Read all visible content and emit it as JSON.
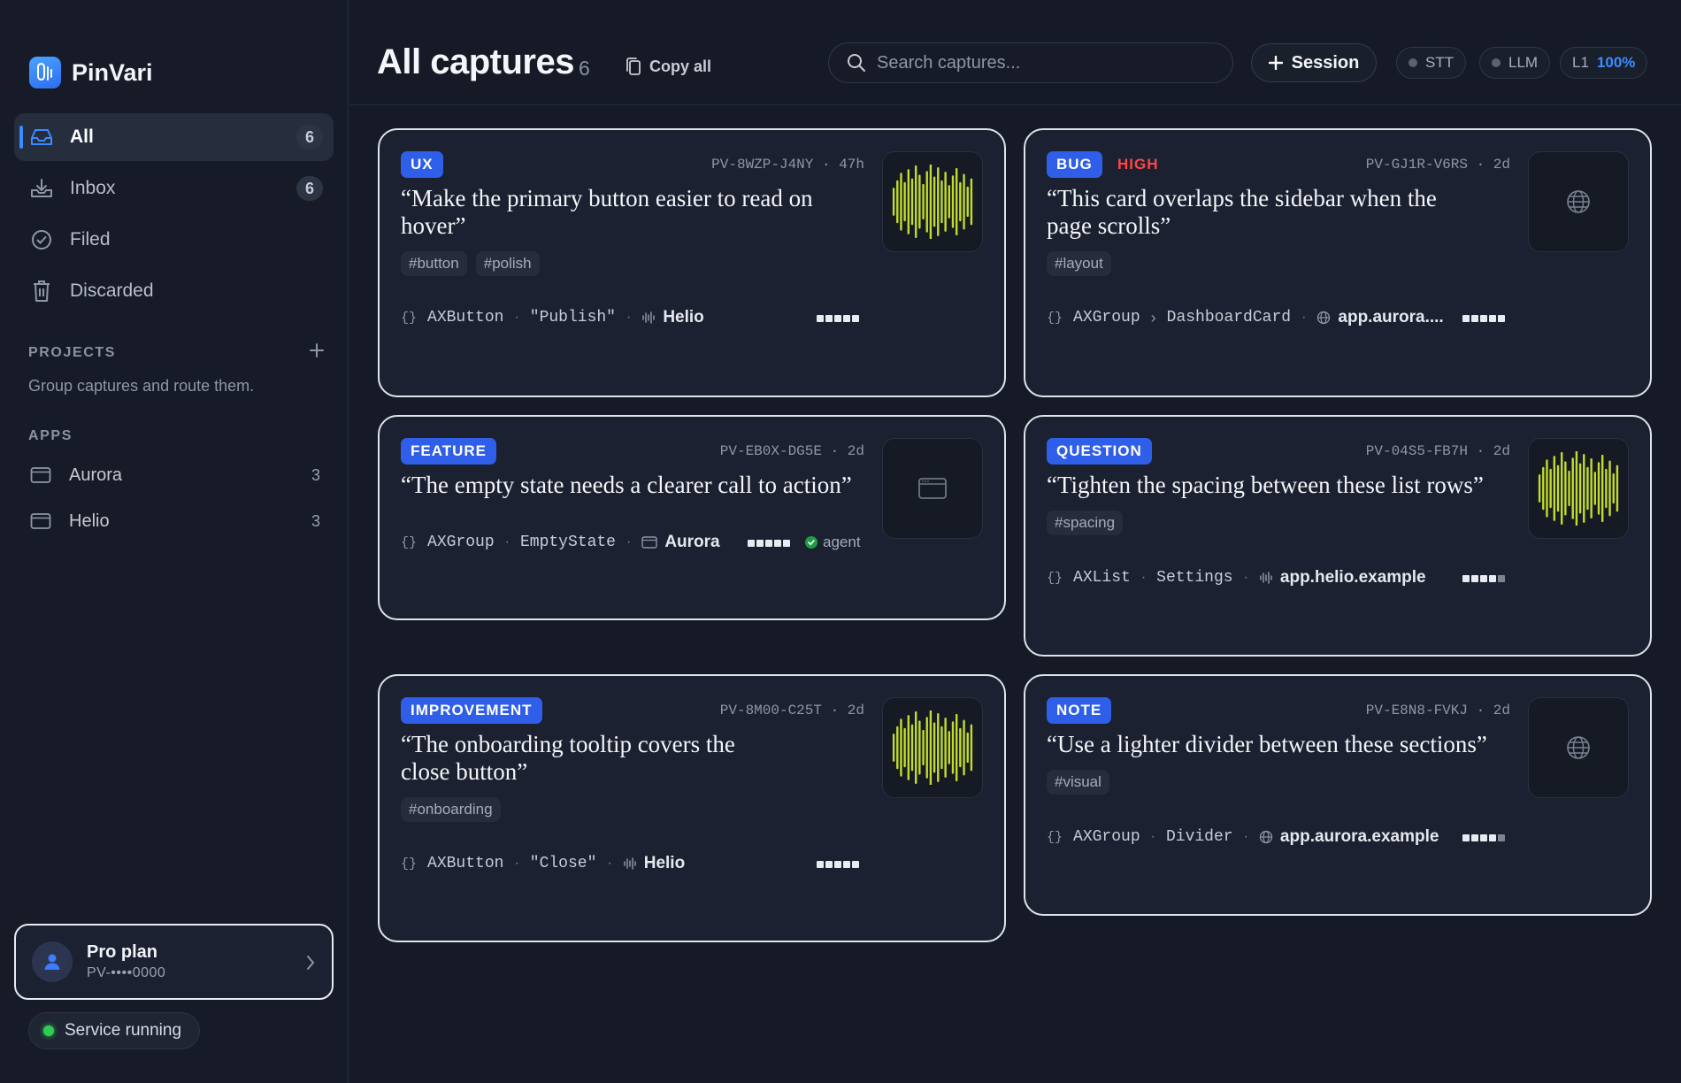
{
  "app": {
    "name": "PinVari"
  },
  "sidebar": {
    "nav": [
      {
        "label": "All",
        "count": "6",
        "icon": "inbox-tray-icon"
      },
      {
        "label": "Inbox",
        "count": "6",
        "icon": "download-tray-icon"
      },
      {
        "label": "Filed",
        "icon": "check-circle-icon"
      },
      {
        "label": "Discarded",
        "icon": "trash-icon"
      }
    ],
    "projects": {
      "title": "PROJECTS",
      "description": "Group captures and route them."
    },
    "apps": {
      "title": "APPS",
      "items": [
        {
          "label": "Aurora",
          "count": "3"
        },
        {
          "label": "Helio",
          "count": "3"
        }
      ]
    },
    "plan": {
      "name": "Pro plan",
      "id": "PV-••••0000"
    },
    "service": {
      "label": "Service running",
      "color": "#2ecc52"
    }
  },
  "header": {
    "title": "All captures",
    "count": "6",
    "copy_all": "Copy all",
    "search_placeholder": "Search captures...",
    "session_label": "Session",
    "status": {
      "stt": "STT",
      "llm": "LLM",
      "level": "L1",
      "percent": "100%"
    }
  },
  "colors": {
    "accent": "#2f5fe8",
    "priority_high": "#ff4545",
    "waveform": "#c3dc2b",
    "background": "#151a26"
  },
  "cards": [
    {
      "tag": "UX",
      "id": "PV-8WZP-J4NY",
      "age": "47h",
      "quote": "“Make the primary button easier to read on hover”",
      "hashtags": [
        "#button",
        "#polish"
      ],
      "role": "AXButton",
      "element": "\"Publish\"",
      "app": "Helio",
      "app_icon": "waveform-icon",
      "rating": 5,
      "thumbnail": "waveform"
    },
    {
      "tag": "BUG",
      "priority": "HIGH",
      "id": "PV-GJ1R-V6RS",
      "age": "2d",
      "quote": "“This card overlaps the sidebar when the page scrolls”",
      "hashtags": [
        "#layout"
      ],
      "role": "AXGroup",
      "element": "DashboardCard",
      "app": "app.aurora....",
      "app_icon": "globe-icon",
      "rating": 5,
      "thumbnail": "globe"
    },
    {
      "tag": "FEATURE",
      "id": "PV-EB0X-DG5E",
      "age": "2d",
      "quote": "“The empty state needs a clearer call to action”",
      "role": "AXGroup",
      "element": "EmptyState",
      "app": "Aurora",
      "app_icon": "window-icon",
      "rating": 5,
      "agent": "agent",
      "thumbnail": "window"
    },
    {
      "tag": "QUESTION",
      "id": "PV-04S5-FB7H",
      "age": "2d",
      "quote": "“Tighten the spacing between these list rows”",
      "hashtags": [
        "#spacing"
      ],
      "role": "AXList",
      "element": "Settings",
      "app": "app.helio.example",
      "app_icon": "waveform-icon",
      "rating": 4,
      "thumbnail": "waveform"
    },
    {
      "tag": "IMPROVEMENT",
      "id": "PV-8M00-C25T",
      "age": "2d",
      "quote": "“The onboarding tooltip covers the close button”",
      "hashtags": [
        "#onboarding"
      ],
      "role": "AXButton",
      "element": "\"Close\"",
      "app": "Helio",
      "app_icon": "waveform-icon",
      "rating": 5,
      "thumbnail": "waveform"
    },
    {
      "tag": "NOTE",
      "id": "PV-E8N8-FVKJ",
      "age": "2d",
      "quote": "“Use a lighter divider between these sections”",
      "hashtags": [
        "#visual"
      ],
      "role": "AXGroup",
      "element": "Divider",
      "app": "app.aurora.example",
      "app_icon": "globe-icon",
      "rating": 4,
      "thumbnail": "globe"
    }
  ]
}
